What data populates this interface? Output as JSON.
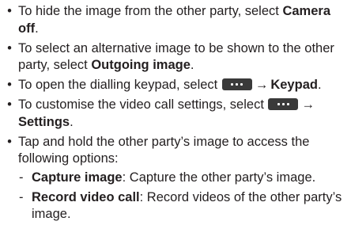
{
  "bullets": {
    "camera_off": {
      "marker": "•",
      "text_before": "To hide the image from the other party, select ",
      "bold": "Camera off",
      "text_after": "."
    },
    "outgoing_image": {
      "marker": "•",
      "text_before": "To select an alternative image to be shown to the other party, select ",
      "bold": "Outgoing image",
      "text_after": "."
    },
    "keypad": {
      "marker": "•",
      "text_before": "To open the dialling keypad, select ",
      "arrow": "→",
      "bold": "Keypad",
      "text_after": "."
    },
    "settings": {
      "marker": "•",
      "text_before": "To customise the video call settings, select ",
      "arrow": "→",
      "bold": "Settings",
      "text_after": "."
    },
    "tap_hold": {
      "marker": "•",
      "text": "Tap and hold the other party’s image to access the following options:",
      "sub_items": {
        "capture": {
          "marker": "-",
          "bold": "Capture image",
          "text": ": Capture the other party’s image."
        },
        "record": {
          "marker": "-",
          "bold": "Record video call",
          "text": ": Record videos of the other party’s image."
        }
      }
    }
  },
  "icons": {
    "more_options": "more-options-icon"
  }
}
